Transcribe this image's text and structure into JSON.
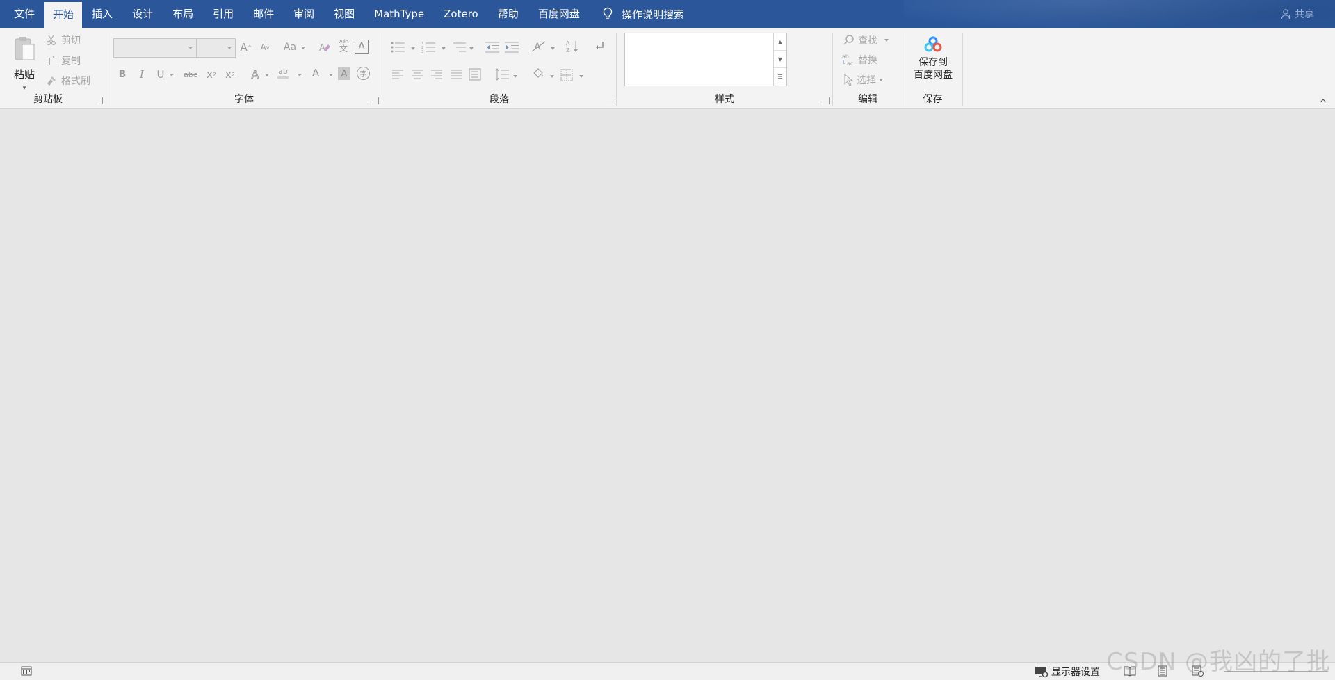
{
  "tabs": [
    {
      "label": "文件",
      "active": false
    },
    {
      "label": "开始",
      "active": true
    },
    {
      "label": "插入",
      "active": false
    },
    {
      "label": "设计",
      "active": false
    },
    {
      "label": "布局",
      "active": false
    },
    {
      "label": "引用",
      "active": false
    },
    {
      "label": "邮件",
      "active": false
    },
    {
      "label": "审阅",
      "active": false
    },
    {
      "label": "视图",
      "active": false
    },
    {
      "label": "MathType",
      "active": false
    },
    {
      "label": "Zotero",
      "active": false
    },
    {
      "label": "帮助",
      "active": false
    },
    {
      "label": "百度网盘",
      "active": false
    }
  ],
  "tell_me": {
    "label": "操作说明搜索",
    "icon": "lightbulb-icon"
  },
  "share": {
    "label": "共享",
    "icon": "person-icon"
  },
  "clipboard": {
    "paste_label": "粘贴",
    "cut_label": "剪切",
    "copy_label": "复制",
    "format_painter_label": "格式刷",
    "group_label": "剪贴板"
  },
  "font": {
    "group_label": "字体",
    "grow_glyph": "A",
    "shrink_glyph": "A",
    "case_glyph": "Aa",
    "bold_glyph": "B",
    "italic_glyph": "I",
    "underline_glyph": "U",
    "strike_glyph": "abc",
    "subscript_glyph": "x",
    "subscript_sub": "2",
    "superscript_glyph": "x",
    "superscript_sup": "2",
    "phonetic_glyph": "文",
    "phonetic_top": "wén",
    "border_glyph": "A",
    "effects_glyph": "A",
    "highlight_glyph": "ab",
    "color_glyph": "A",
    "shade_glyph": "A",
    "enclose_glyph": "字"
  },
  "paragraph": {
    "group_label": "段落"
  },
  "styles": {
    "group_label": "样式"
  },
  "editing": {
    "group_label": "编辑",
    "find_label": "查找",
    "replace_label": "替换",
    "select_label": "选择"
  },
  "save": {
    "group_label": "保存",
    "baidu_line1": "保存到",
    "baidu_line2": "百度网盘"
  },
  "statusbar": {
    "display_settings_label": "显示器设置"
  },
  "watermark": "CSDN @我凶的了批",
  "colors": {
    "tab_bar": "#2b579a",
    "ribbon": "#f3f3f3",
    "canvas": "#e6e6e6",
    "baidu_blue": "#2f8dff"
  }
}
